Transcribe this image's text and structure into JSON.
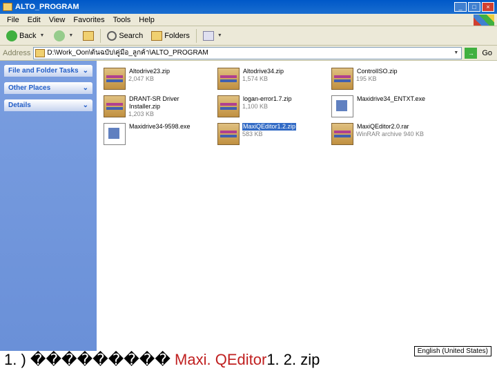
{
  "title": "ALTO_PROGRAM",
  "menu": {
    "file": "File",
    "edit": "Edit",
    "view": "View",
    "favorites": "Favorites",
    "tools": "Tools",
    "help": "Help"
  },
  "toolbar": {
    "back": "Back",
    "search": "Search",
    "folders": "Folders"
  },
  "address": {
    "label": "Address",
    "path": "D:\\Work_Oon\\ต้นฉบับ\\คู่มือ_ลูกค้า\\ALTO_PROGRAM",
    "go": "Go"
  },
  "panels": {
    "tasks": "File and Folder Tasks",
    "places": "Other Places",
    "details": "Details"
  },
  "files": [
    {
      "icon": "rar",
      "name": "Altodrive23.zip",
      "meta": "2,047 KB",
      "sel": false
    },
    {
      "icon": "rar",
      "name": "Altodrive34.zip",
      "meta": "1,574 KB",
      "sel": false
    },
    {
      "icon": "rar",
      "name": "ControlISO.zip",
      "meta": "195 KB",
      "sel": false
    },
    {
      "icon": "rar",
      "name": "DRANT-SR Driver Installer.zip",
      "meta": "1,203 KB",
      "sel": false
    },
    {
      "icon": "rar",
      "name": "logan-error1.7.zip",
      "meta": "1,100 KB",
      "sel": false
    },
    {
      "icon": "exe",
      "name": "Maxidrive34_ENTXT.exe",
      "meta": "",
      "sel": false
    },
    {
      "icon": "exe",
      "name": "Maxidrive34-9598.exe",
      "meta": "",
      "sel": false
    },
    {
      "icon": "rar",
      "name": "MaxiQEditor1.2.zip",
      "meta": "583 KB",
      "sel": true
    },
    {
      "icon": "rar",
      "name": "MaxiQEditor2.0.rar",
      "meta": "WinRAR archive\n940 KB",
      "sel": false
    }
  ],
  "caption": {
    "prefix": "1. ) ���������",
    "mid": " Maxi. QEditor",
    "suffix": "1. 2. zip"
  },
  "lang": "English (United States)"
}
